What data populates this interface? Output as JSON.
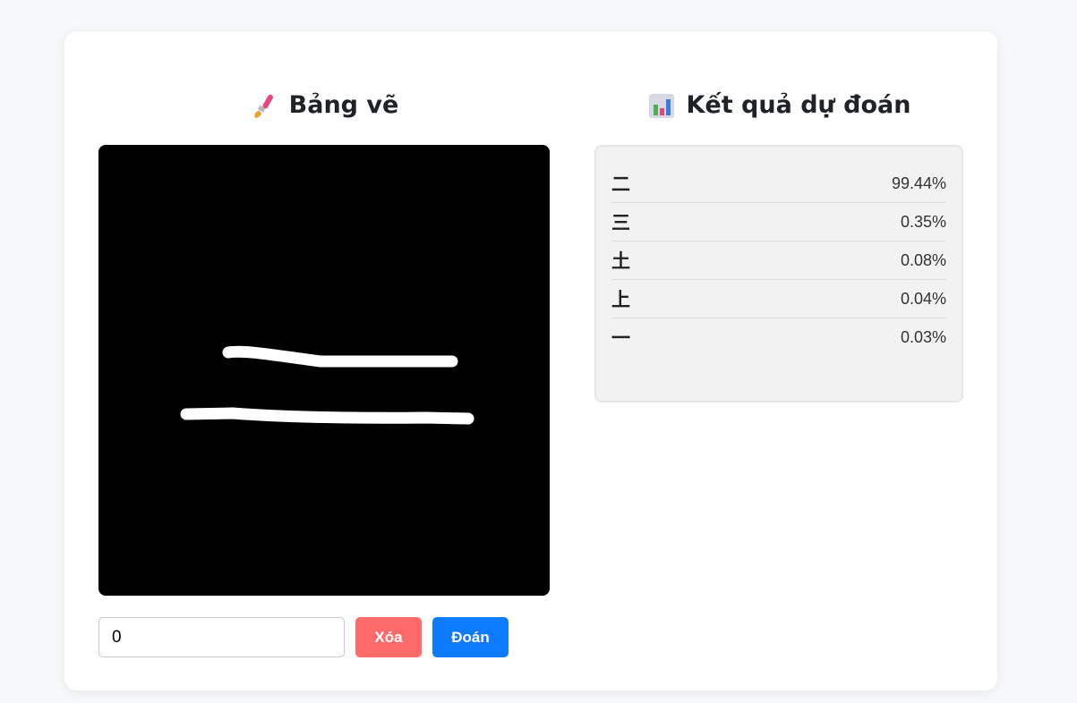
{
  "canvas_panel": {
    "title": "Bảng vẽ",
    "title_icon": "paintbrush-icon"
  },
  "results_panel": {
    "title": "Kết quả dự đoán",
    "title_icon": "bar-chart-icon",
    "predictions": [
      {
        "char": "二",
        "percent": "99.44%"
      },
      {
        "char": "三",
        "percent": "0.35%"
      },
      {
        "char": "土",
        "percent": "0.08%"
      },
      {
        "char": "上",
        "percent": "0.04%"
      },
      {
        "char": "一",
        "percent": "0.03%"
      }
    ]
  },
  "controls": {
    "input_value": "0",
    "clear_label": "Xóa",
    "guess_label": "Đoán"
  },
  "colors": {
    "clear_button": "#ff6b6b",
    "guess_button": "#0d7bff",
    "canvas_background": "#000000",
    "stroke": "#ffffff"
  }
}
